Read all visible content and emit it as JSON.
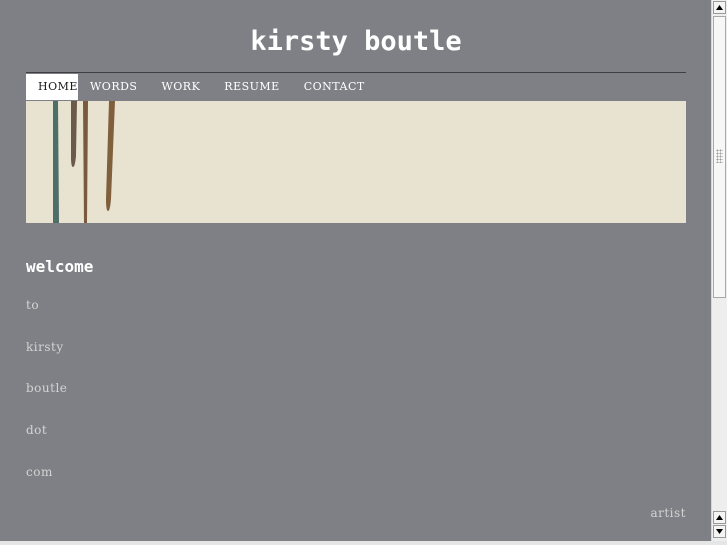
{
  "site": {
    "title": "kirsty boutle"
  },
  "nav": {
    "items": [
      {
        "label": "HOME",
        "active": true
      },
      {
        "label": "WORDS",
        "active": false
      },
      {
        "label": "WORK",
        "active": false
      },
      {
        "label": "RESUME",
        "active": false
      },
      {
        "label": "CONTACT",
        "active": false
      }
    ]
  },
  "banner": {
    "background_color": "#e8e3d1",
    "drip_colors": [
      "#4d6e69",
      "#6b5a4a",
      "#7a5a3e",
      "#7f5f3c"
    ]
  },
  "main": {
    "heading": "welcome",
    "words": [
      "to",
      "kirsty",
      "boutle",
      "dot",
      "com"
    ],
    "tagline": "artist"
  },
  "colors": {
    "page_background": "#7f8085",
    "nav_active_background": "#ffffff",
    "text_light": "#d4d4d4"
  }
}
